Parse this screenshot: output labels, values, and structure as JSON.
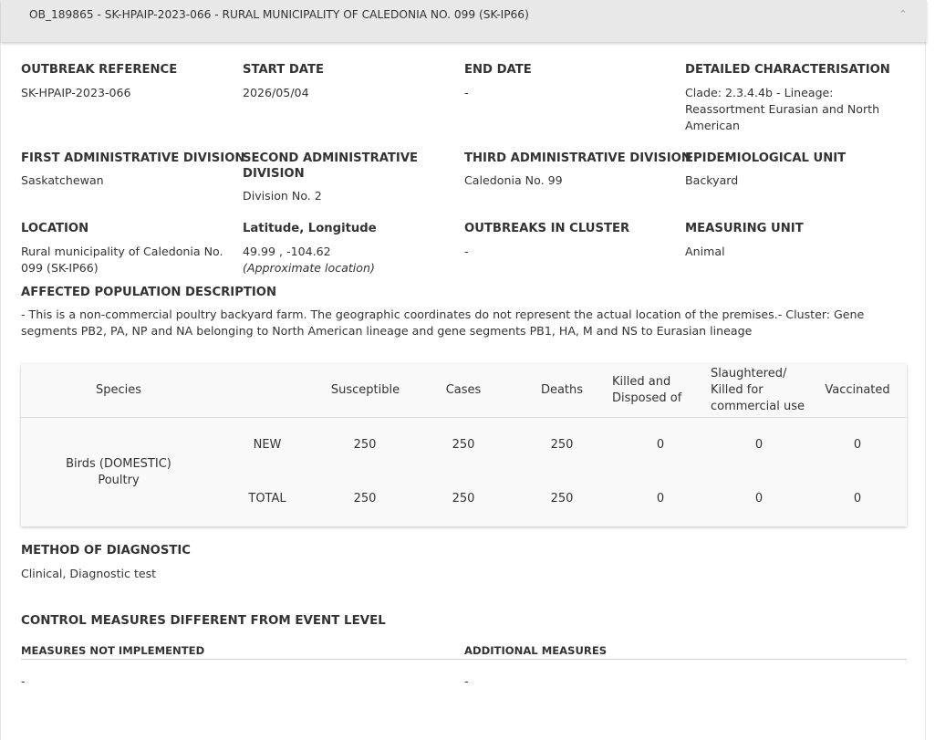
{
  "header": {
    "title": "OB_189865 - SK-HPAIP-2023-066 - RURAL MUNICIPALITY OF CALEDONIA NO. 099 (SK-IP66)",
    "chevron": "⌃"
  },
  "fields": {
    "outbreak_reference": {
      "label": "OUTBREAK REFERENCE",
      "value": "SK-HPAIP-2023-066"
    },
    "start_date": {
      "label": "START DATE",
      "value": "2026/05/04"
    },
    "end_date": {
      "label": "END DATE",
      "value": "-"
    },
    "detailed_characterisation": {
      "label": "DETAILED CHARACTERISATION",
      "value": "Clade: 2.3.4.4b - Lineage: Reassortment Eurasian and North American"
    },
    "first_admin_division": {
      "label": "FIRST ADMINISTRATIVE DIVISION",
      "value": "Saskatchewan"
    },
    "second_admin_division": {
      "label": "SECOND ADMINISTRATIVE DIVISION",
      "value": "Division No. 2"
    },
    "third_admin_division": {
      "label": "THIRD ADMINISTRATIVE DIVISION",
      "value": "Caledonia No. 99"
    },
    "epidemiological_unit": {
      "label": "EPIDEMIOLOGICAL UNIT",
      "value": "Backyard"
    },
    "location": {
      "label": "LOCATION",
      "value": "Rural municipality of Caledonia No. 099 (SK-IP66)"
    },
    "lat_long": {
      "label": "Latitude, Longitude",
      "value": "49.99 , -104.62",
      "note": "(Approximate location)"
    },
    "outbreaks_in_cluster": {
      "label": "OUTBREAKS IN CLUSTER",
      "value": "-"
    },
    "measuring_unit": {
      "label": "MEASURING UNIT",
      "value": "Animal"
    },
    "affected_population": {
      "label": "AFFECTED POPULATION DESCRIPTION",
      "value": "- This is a non-commercial poultry backyard farm. The geographic coordinates do not represent the actual location of the premises.- Cluster: Gene segments PB2, PA, NP and NA belonging to North American lineage and gene segments PB1, HA, M and NS to Eurasian lineage"
    }
  },
  "table": {
    "headers": {
      "species": "Species",
      "susceptible": "Susceptible",
      "cases": "Cases",
      "deaths": "Deaths",
      "killed": "Killed and Disposed of",
      "slaughtered": "Slaughtered/ Killed for commercial use",
      "vaccinated": "Vaccinated"
    },
    "species": "Birds (DOMESTIC) Poultry",
    "rows": [
      {
        "type": "NEW",
        "susceptible": "250",
        "cases": "250",
        "deaths": "250",
        "killed": "0",
        "slaughtered": "0",
        "vaccinated": "0"
      },
      {
        "type": "TOTAL",
        "susceptible": "250",
        "cases": "250",
        "deaths": "250",
        "killed": "0",
        "slaughtered": "0",
        "vaccinated": "0"
      }
    ]
  },
  "diagnostic": {
    "label": "METHOD OF DIAGNOSTIC",
    "value": "Clinical, Diagnostic test"
  },
  "control": {
    "title": "CONTROL MEASURES DIFFERENT FROM EVENT LEVEL",
    "not_implemented_label": "MEASURES NOT IMPLEMENTED",
    "not_implemented_value": "-",
    "additional_label": "ADDITIONAL MEASURES",
    "additional_value": "-"
  },
  "colors": {
    "header_bg": "#e8e8e8",
    "table_bg": "#f9f9f9",
    "text": "#333333"
  }
}
